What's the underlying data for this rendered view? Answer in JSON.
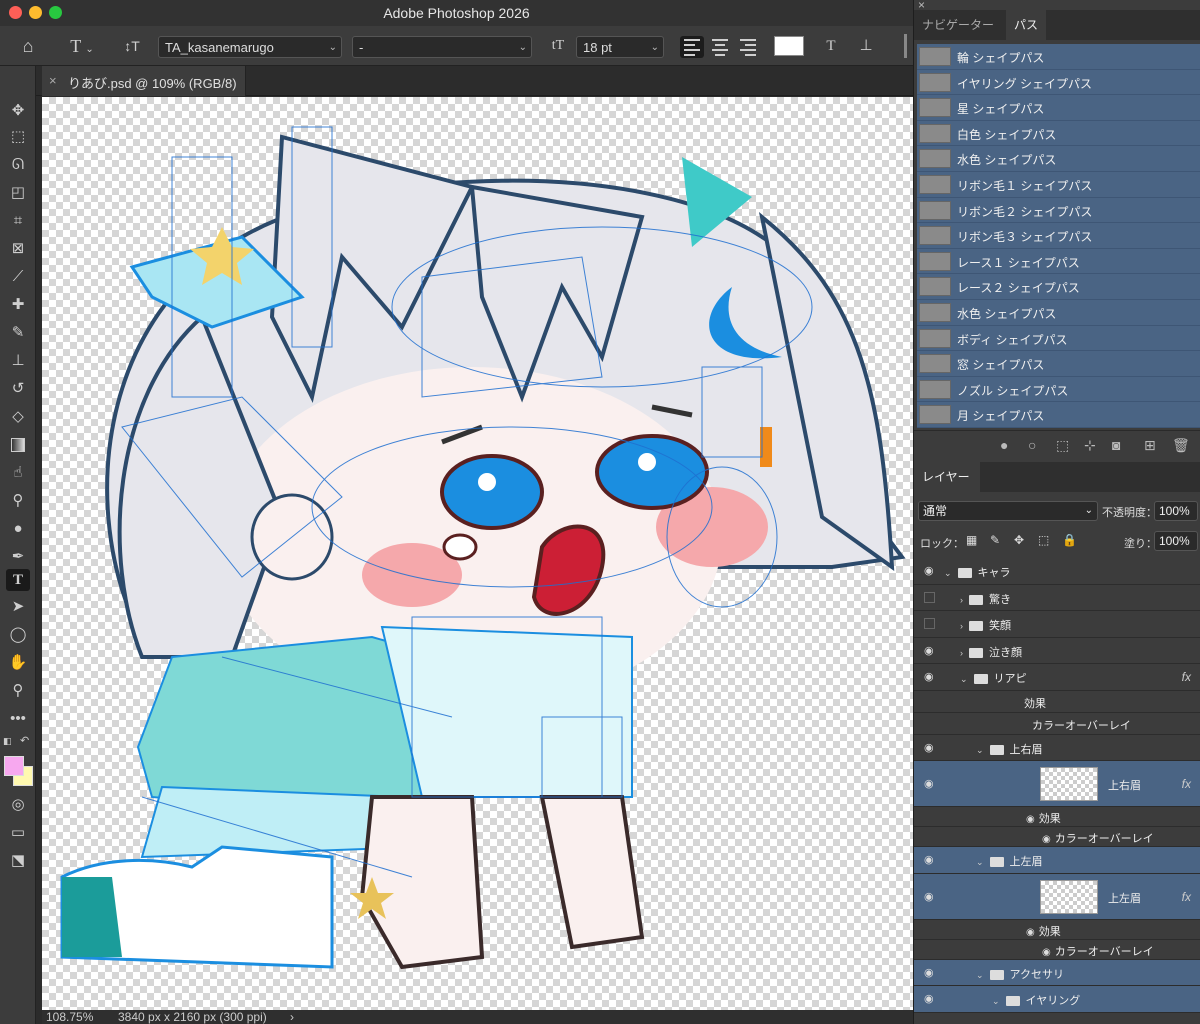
{
  "app": {
    "title": "Adobe Photoshop 2026"
  },
  "options": {
    "font_family": "TA_kasanemarugo",
    "font_style": "-",
    "font_size": "18 pt",
    "text_color": "#ffffff"
  },
  "document": {
    "tab_title": "りあび.psd @ 109% (RGB/8)",
    "zoom": "108.75%",
    "dimensions": "3840 px x 2160 px (300 ppi)"
  },
  "tools": [
    "move-tool",
    "marquee-tool",
    "lasso-tool",
    "object-select-tool",
    "crop-tool",
    "frame-tool",
    "eyedropper-tool",
    "healing-tool",
    "brush-tool",
    "stamp-tool",
    "history-brush-tool",
    "eraser-tool",
    "gradient-tool",
    "smudge-tool",
    "dodge-tool",
    "burn-tool",
    "pen-tool",
    "type-tool",
    "path-select-tool",
    "shape-tool",
    "hand-tool",
    "zoom-tool",
    "more-tools"
  ],
  "colors": {
    "foreground": "#f7a8ef",
    "background": "#fff9b0"
  },
  "panels": {
    "tab_navigator": "ナビゲーター",
    "tab_paths": "パス",
    "tab_layers": "レイヤー"
  },
  "paths": [
    "輪 シェイプパス",
    "イヤリング シェイプパス",
    "星 シェイプパス",
    "白色 シェイプパス",
    "水色 シェイプパス",
    "リボン毛１ シェイプパス",
    "リボン毛２ シェイプパス",
    "リボン毛３ シェイプパス",
    "レース１ シェイプパス",
    "レース２ シェイプパス",
    "水色 シェイプパス",
    "ボディ シェイプパス",
    "窓 シェイプパス",
    "ノズル シェイプパス",
    "月 シェイプパス"
  ],
  "layers_panel": {
    "blend_mode": "通常",
    "opacity_label": "不透明度：",
    "opacity": "100%",
    "lock_label": "ロック：",
    "fill_label": "塗り：",
    "fill": "100%"
  },
  "layers": [
    {
      "name": "キャラ",
      "visible": true,
      "indent": 0,
      "type": "group",
      "open": true
    },
    {
      "name": "驚き",
      "visible": false,
      "indent": 1,
      "type": "group",
      "open": false
    },
    {
      "name": "笑顔",
      "visible": false,
      "indent": 1,
      "type": "group",
      "open": false
    },
    {
      "name": "泣き顔",
      "visible": true,
      "indent": 1,
      "type": "group",
      "open": false
    },
    {
      "name": "リアピ",
      "visible": true,
      "indent": 1,
      "type": "group",
      "open": true,
      "fx": true
    },
    {
      "name": "効果",
      "indent": 2,
      "type": "effect-header"
    },
    {
      "name": "カラーオーバーレイ",
      "indent": 3,
      "type": "effect"
    },
    {
      "name": "上右眉",
      "visible": true,
      "indent": 2,
      "type": "group",
      "open": true
    },
    {
      "name": "上右眉",
      "visible": true,
      "indent": 3,
      "type": "layer",
      "fx": true,
      "selected": true
    },
    {
      "name": "効果",
      "indent": 3,
      "type": "effect-sub"
    },
    {
      "name": "カラーオーバーレイ",
      "indent": 4,
      "type": "effect-sub"
    },
    {
      "name": "上左眉",
      "visible": true,
      "indent": 2,
      "type": "group",
      "open": true,
      "selected": true
    },
    {
      "name": "上左眉",
      "visible": true,
      "indent": 3,
      "type": "layer",
      "fx": true,
      "selected": true
    },
    {
      "name": "効果",
      "indent": 3,
      "type": "effect-sub"
    },
    {
      "name": "カラーオーバーレイ",
      "indent": 4,
      "type": "effect-sub"
    },
    {
      "name": "アクセサリ",
      "visible": true,
      "indent": 2,
      "type": "group",
      "open": true,
      "selected": true
    },
    {
      "name": "イヤリング",
      "visible": true,
      "indent": 3,
      "type": "group",
      "open": true,
      "selected": true
    }
  ]
}
